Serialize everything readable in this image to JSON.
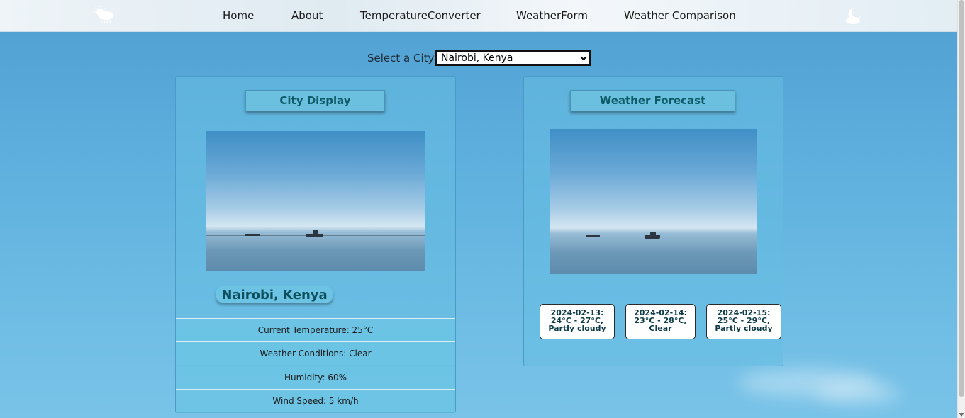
{
  "nav": {
    "links": [
      "Home",
      "About",
      "TemperatureConverter",
      "WeatherForm",
      "Weather Comparison"
    ]
  },
  "city_select": {
    "label": "Select a City:",
    "selected": "Nairobi, Kenya"
  },
  "city_display": {
    "heading": "City Display",
    "name": "Nairobi, Kenya",
    "stats": [
      "Current Temperature: 25°C",
      "Weather Conditions: Clear",
      "Humidity: 60%",
      "Wind Speed: 5 km/h"
    ]
  },
  "forecast": {
    "heading": "Weather Forecast",
    "cards": [
      {
        "line1": "2024-02-13:",
        "line2": "24°C - 27°C,",
        "line3": "Partly cloudy"
      },
      {
        "line1": "2024-02-14:",
        "line2": "23°C - 28°C,",
        "line3": "Clear"
      },
      {
        "line1": "2024-02-15:",
        "line2": "25°C - 29°C,",
        "line3": "Partly cloudy"
      }
    ]
  },
  "icons": {
    "logo": "cloud-sun-rain-icon",
    "theme": "cloud-moon-icon"
  }
}
